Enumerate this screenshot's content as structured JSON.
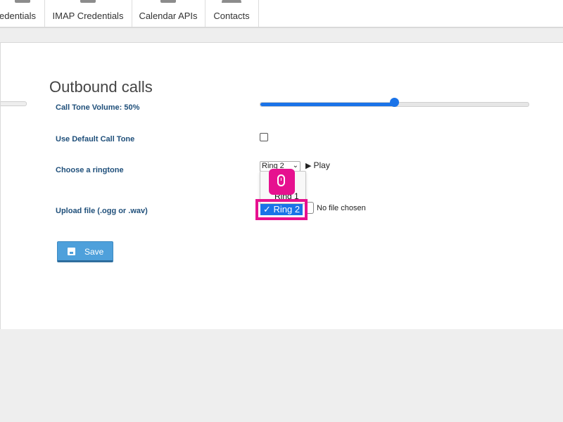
{
  "tabs": [
    {
      "label": "edentials",
      "icon": "calendar-icon"
    },
    {
      "label": "IMAP Credentials",
      "icon": "envelope-icon"
    },
    {
      "label": "Calendar APIs",
      "icon": "calendar-grid-icon"
    },
    {
      "label": "Contacts",
      "icon": "contacts-icon"
    }
  ],
  "section": {
    "heading": "Outbound calls"
  },
  "fields": {
    "volume": {
      "label": "Call Tone Volume: 50%",
      "value_percent": 50
    },
    "default_tone": {
      "label": "Use Default Call Tone",
      "checked": false
    },
    "ringtone": {
      "label": "Choose a ringtone",
      "selected": "Ring 2",
      "play_label": "Play",
      "options": [
        "Ring 1",
        "Ring 2"
      ]
    },
    "upload": {
      "label": "Upload file (.ogg or .wav)",
      "status": "No file chosen"
    }
  },
  "dropdown": {
    "option1": "Ring 1",
    "highlighted": "✓ Ring 2"
  },
  "buttons": {
    "save": "Save"
  },
  "colors": {
    "accent": "#1a73e8",
    "highlight": "#e6118f",
    "label": "#1f4f7a",
    "save_button": "#4ea0db"
  }
}
